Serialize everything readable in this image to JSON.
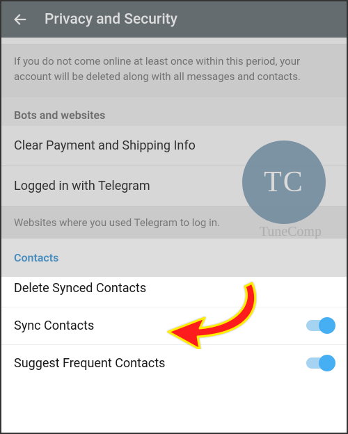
{
  "header": {
    "title": "Privacy and Security"
  },
  "inactivity_note": "If you do not come online at least once within this period, your account will be deleted along with all messages and contacts.",
  "bots_section": {
    "header": "Bots and websites",
    "clear_payment": "Clear Payment and Shipping Info",
    "logged_in": "Logged in with Telegram",
    "footer": "Websites where you used Telegram to log in."
  },
  "contacts_section": {
    "header": "Contacts",
    "delete_synced": "Delete Synced Contacts",
    "sync_contacts": "Sync Contacts",
    "suggest_frequent": "Suggest Frequent Contacts"
  },
  "watermark": {
    "logo": "TC",
    "text": "TuneComp"
  }
}
